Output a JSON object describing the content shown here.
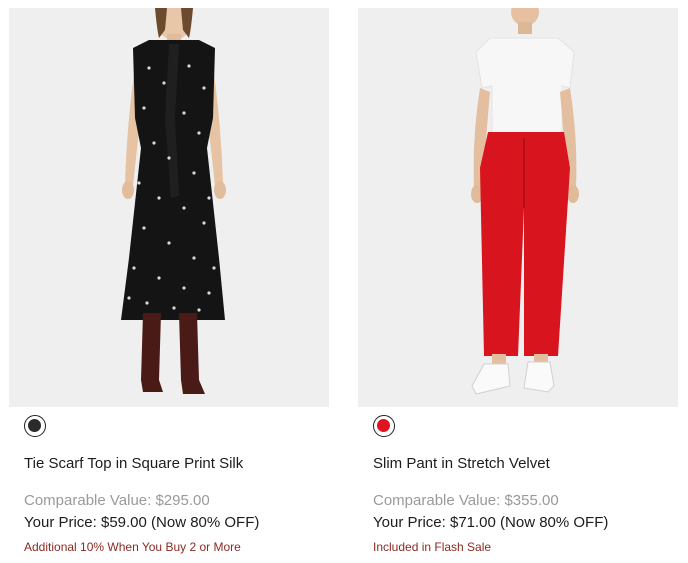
{
  "products": [
    {
      "name": "Tie Scarf Top in Square Print Silk",
      "swatch_color": "#2b2b2b",
      "comparable": "Comparable Value: $295.00",
      "your_price": "Your Price: $59.00 (Now 80% OFF)",
      "promo": "Additional 10% When You Buy 2 or More",
      "image_icon": "model-black-polka-dot-dress-photo"
    },
    {
      "name": "Slim Pant in Stretch Velvet",
      "swatch_color": "#e0141e",
      "comparable": "Comparable Value: $355.00",
      "your_price": "Your Price: $71.00 (Now 80% OFF)",
      "promo": "Included in Flash Sale",
      "image_icon": "model-red-velvet-pants-photo"
    }
  ],
  "colors": {
    "image_bg": "#efefef",
    "promo_text": "#8a2a24",
    "comparable_text": "#9a9a9a"
  }
}
